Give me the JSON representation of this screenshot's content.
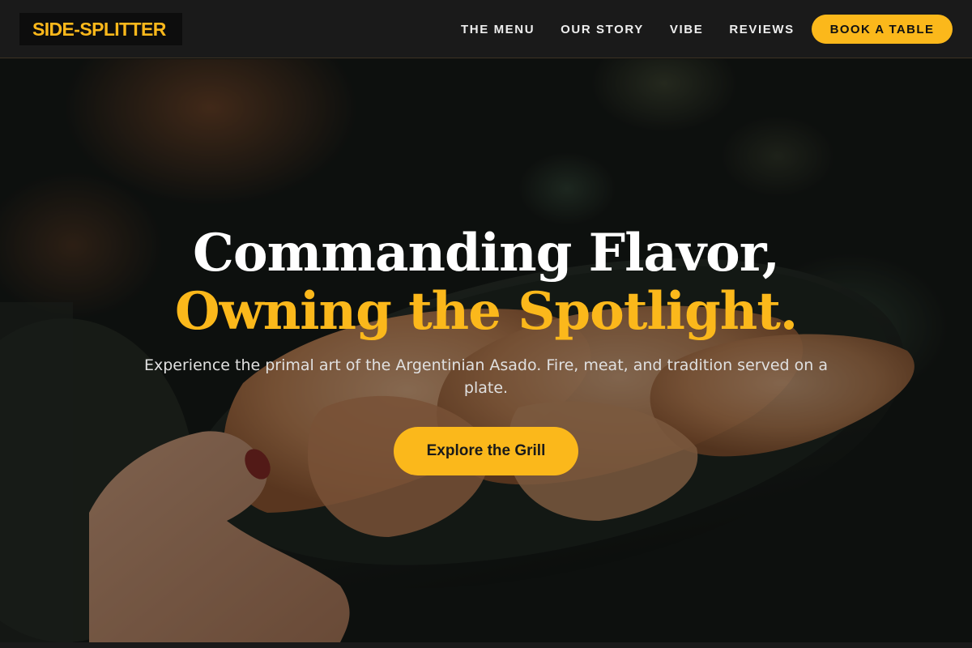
{
  "brand": {
    "logo_text": "SIDE-SPLITTER"
  },
  "nav": {
    "items": [
      {
        "label": "THE MENU"
      },
      {
        "label": "OUR STORY"
      },
      {
        "label": "VIBE"
      },
      {
        "label": "REVIEWS"
      }
    ],
    "cta_label": "BOOK A TABLE"
  },
  "hero": {
    "title_line1": "Commanding Flavor,",
    "title_line2": "Owning the Spotlight.",
    "subtitle": "Experience the primal art of the Argentinian Asado. Fire, meat, and tradition served on a plate.",
    "cta_label": "Explore the Grill",
    "background_icon": "empanada-plate-photo"
  },
  "colors": {
    "accent": "#fbb81b",
    "header_bg": "#1a1a1a",
    "text_light": "#ffffff"
  }
}
